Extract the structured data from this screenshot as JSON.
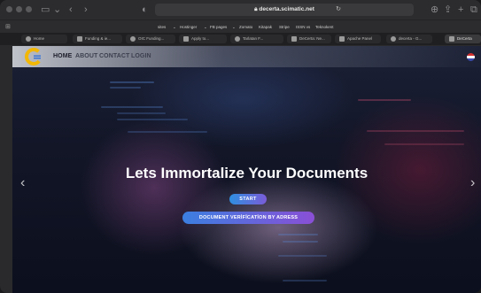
{
  "browser": {
    "url": "decerta.scimatic.net",
    "favorites": [
      "sites",
      "Hostinger",
      "FB pages",
      "Zomato",
      "Kitapak",
      "Stripe",
      "ISSN vs",
      "Teknokent"
    ],
    "tabs": [
      "Home",
      "Funding & ie...",
      "OIC Funding...",
      "Apply to...",
      "Tarlatan F...",
      "DeCerta: Ne...",
      "Apache Panel",
      "decerta - G...",
      "DeCerta"
    ]
  },
  "nav": {
    "links": [
      "HOME",
      "ABOUT",
      "CONTACT",
      "LOGIN"
    ]
  },
  "hero": {
    "headline": "Lets Immortalize Your Documents",
    "start_button": "START",
    "verify_button": "DOCUMENT VERİFİCATİON BY ADRESS",
    "prev_arrow": "‹",
    "next_arrow": "›"
  }
}
